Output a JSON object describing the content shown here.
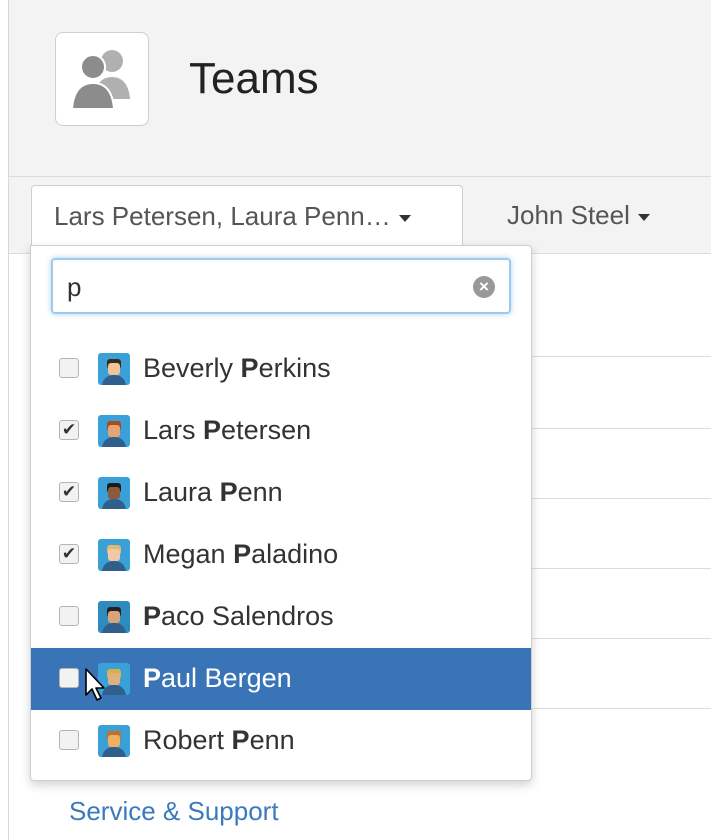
{
  "header": {
    "title": "Teams",
    "icon": "team-icon"
  },
  "filters": [
    {
      "label": "Lars Petersen, Laura Penn…",
      "active": true
    },
    {
      "label": "John Steel",
      "active": false
    }
  ],
  "search": {
    "value": "p",
    "clear_icon": "×"
  },
  "people": [
    {
      "pre": "Beverly ",
      "match": "P",
      "post": "erkins",
      "checked": false,
      "avatar_bg": "#3aa0d8",
      "face": "#f3c49a",
      "hair": "#3a2a1a"
    },
    {
      "pre": "Lars ",
      "match": "P",
      "post": "etersen",
      "checked": true,
      "avatar_bg": "#3aa0d8",
      "face": "#e8a374",
      "hair": "#a64a1f"
    },
    {
      "pre": "Laura ",
      "match": "P",
      "post": "enn",
      "checked": true,
      "avatar_bg": "#3aa0d8",
      "face": "#8a5a3a",
      "hair": "#1a1a1a"
    },
    {
      "pre": "Megan ",
      "match": "P",
      "post": "aladino",
      "checked": true,
      "avatar_bg": "#3aa0d8",
      "face": "#f1c9a8",
      "hair": "#e3b870"
    },
    {
      "pre": "",
      "match": "P",
      "post": "aco Salendros",
      "checked": false,
      "avatar_bg": "#2e8bc0",
      "face": "#d9a47a",
      "hair": "#222222"
    },
    {
      "pre": "",
      "match": "P",
      "post": "aul Bergen",
      "checked": false,
      "highlight": true,
      "avatar_bg": "#3aa0d8",
      "face": "#e0b080",
      "hair": "#d4b24a"
    },
    {
      "pre": "Robert ",
      "match": "P",
      "post": "enn",
      "checked": false,
      "avatar_bg": "#3aa0d8",
      "face": "#f0b060",
      "hair": "#c0722a"
    }
  ],
  "link": {
    "service": "Service & Support"
  },
  "colors": {
    "highlight": "#3874b6",
    "link": "#3b7abf"
  }
}
